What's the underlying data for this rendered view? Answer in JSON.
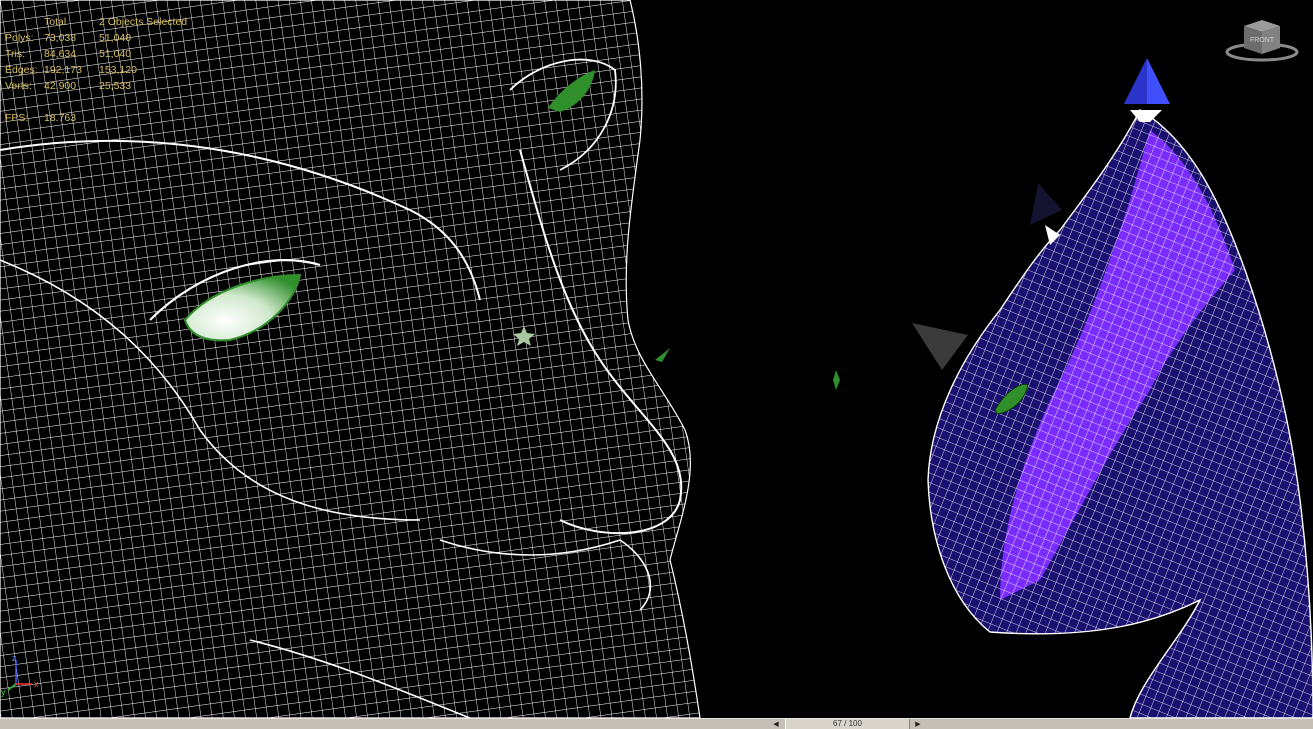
{
  "stats": {
    "headers": {
      "total": "Total",
      "selected": "2 Objects Selected"
    },
    "rows": [
      {
        "label": "Polys:",
        "total": "73,038",
        "selected": "51,040"
      },
      {
        "label": "Tris:",
        "total": "84,634",
        "selected": "51,040"
      },
      {
        "label": "Edges:",
        "total": "192,173",
        "selected": "153,120"
      },
      {
        "label": "Verts:",
        "total": "42,900",
        "selected": "25,533"
      }
    ],
    "fps_label": "FPS:",
    "fps_value": "18.763"
  },
  "viewcube": {
    "label": "FRONT"
  },
  "axes": {
    "x": "x",
    "y": "y",
    "z": "z"
  },
  "timeline": {
    "frame_label": "67 / 100"
  },
  "colors": {
    "stats_text": "#d8c060",
    "wire": "#ffffff",
    "eye_green": "#2f8f2a",
    "selected_fill": "#1a1070",
    "selected_highlight": "#7a2cff",
    "background": "#000000"
  }
}
